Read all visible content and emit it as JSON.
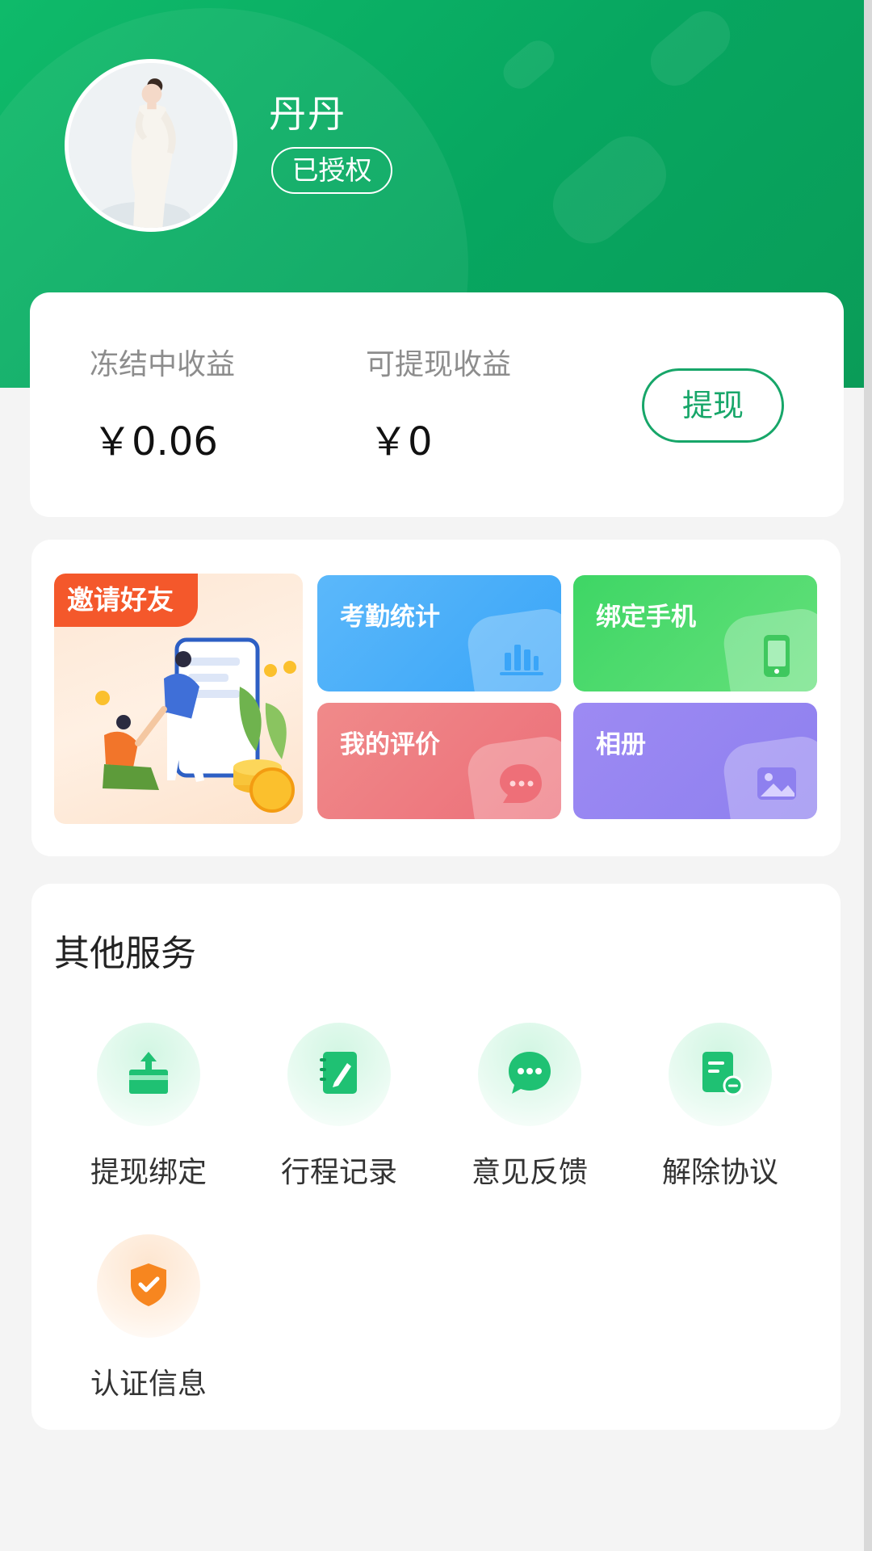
{
  "profile": {
    "name": "丹丹",
    "auth_status": "已授权"
  },
  "earnings": {
    "frozen_label": "冻结中收益",
    "frozen_value": "￥0.06",
    "withdrawable_label": "可提现收益",
    "withdrawable_value": "￥0",
    "withdraw_button": "提现"
  },
  "features": {
    "invite": "邀请好友",
    "tiles": [
      {
        "label": "考勤统计",
        "icon": "bar-chart-icon"
      },
      {
        "label": "绑定手机",
        "icon": "phone-icon"
      },
      {
        "label": "我的评价",
        "icon": "chat-bubble-icon"
      },
      {
        "label": "相册",
        "icon": "image-icon"
      }
    ]
  },
  "services": {
    "title": "其他服务",
    "items": [
      {
        "label": "提现绑定",
        "icon": "upload-card-icon"
      },
      {
        "label": "行程记录",
        "icon": "notebook-pen-icon"
      },
      {
        "label": "意见反馈",
        "icon": "feedback-chat-icon"
      },
      {
        "label": "解除协议",
        "icon": "document-remove-icon"
      },
      {
        "label": "认证信息",
        "icon": "shield-check-icon"
      }
    ]
  },
  "colors": {
    "brand_green": "#07a660",
    "accent_green": "#17a669",
    "invite_orange": "#f4582b"
  }
}
